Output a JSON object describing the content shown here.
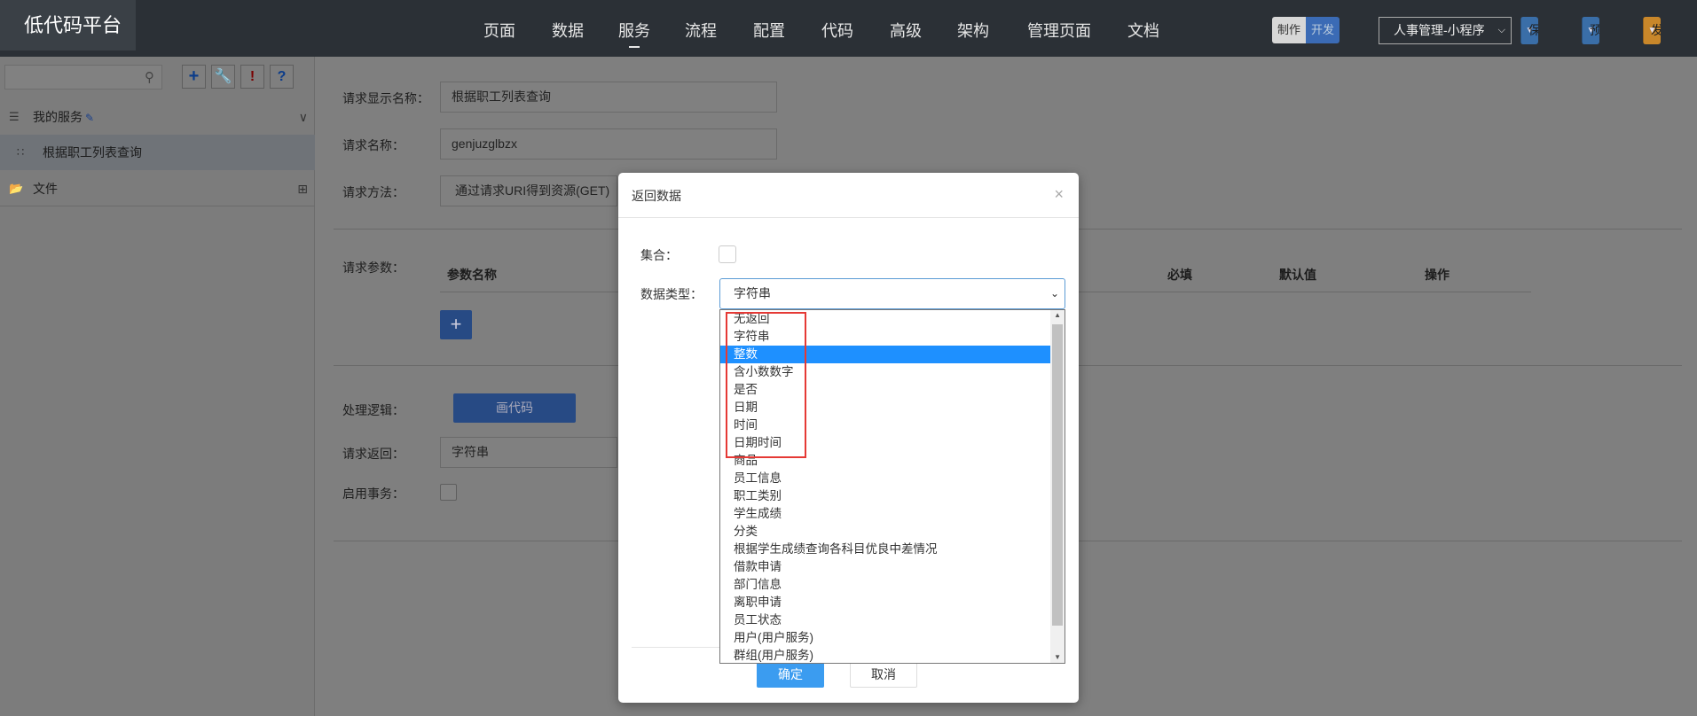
{
  "header": {
    "logo": "低代码平台",
    "nav": [
      "页面",
      "数据",
      "服务",
      "流程",
      "配置",
      "代码",
      "高级",
      "架构",
      "管理页面",
      "文档"
    ],
    "active_nav": "服务",
    "mode": {
      "make": "制作",
      "dev": "开发"
    },
    "project": "人事管理-小程序",
    "save": "保存",
    "preview": "预览",
    "publish": "发布"
  },
  "sidebar": {
    "search_placeholder": "",
    "tools": {
      "add": "+",
      "warn": "!",
      "help": "?"
    },
    "my_services": "我的服务",
    "service_item": "根据职工列表查询",
    "files": "文件"
  },
  "form": {
    "display_name_label": "请求显示名称：",
    "display_name_value": "根据职工列表查询",
    "name_label": "请求名称：",
    "name_value": "genjuzglbzx",
    "method_label": "请求方法：",
    "method_value": "通过请求URI得到资源(GET)",
    "params_label": "请求参数：",
    "params_columns": {
      "name": "参数名称",
      "required": "必填",
      "default": "默认值",
      "ops": "操作"
    },
    "add_param": "+",
    "logic_label": "处理逻辑：",
    "draw_code": "画代码",
    "return_label": "请求返回：",
    "return_value": "字符串",
    "transaction_label": "启用事务："
  },
  "modal": {
    "title": "返回数据",
    "close": "×",
    "collection_label": "集合：",
    "type_label": "数据类型：",
    "type_value": "字符串",
    "ok": "确定",
    "cancel": "取消"
  },
  "dropdown": {
    "options": [
      "无返回",
      "字符串",
      "整数",
      "含小数数字",
      "是否",
      "日期",
      "时间",
      "日期时间",
      "商品",
      "员工信息",
      "职工类别",
      "学生成绩",
      "分类",
      "根据学生成绩查询各科目优良中差情况",
      "借款申请",
      "部门信息",
      "离职申请",
      "员工状态",
      "用户(用户服务)",
      "群组(用户服务)"
    ],
    "selected": "整数",
    "highlight_color": "#e53935"
  }
}
